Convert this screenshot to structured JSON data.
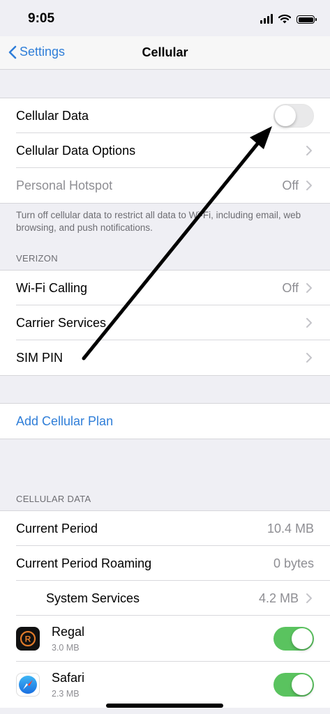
{
  "status_bar": {
    "time": "9:05"
  },
  "nav": {
    "back_label": "Settings",
    "title": "Cellular"
  },
  "main_group": {
    "cellular_data": {
      "label": "Cellular Data",
      "state": "off"
    },
    "cellular_data_options": {
      "label": "Cellular Data Options"
    },
    "personal_hotspot": {
      "label": "Personal Hotspot",
      "value": "Off"
    }
  },
  "main_footer": "Turn off cellular data to restrict all data to Wi-Fi, including email, web browsing, and push notifications.",
  "carrier": {
    "header": "VERIZON",
    "wifi_calling": {
      "label": "Wi-Fi Calling",
      "value": "Off"
    },
    "carrier_services": {
      "label": "Carrier Services"
    },
    "sim_pin": {
      "label": "SIM PIN"
    }
  },
  "add_plan": {
    "label": "Add Cellular Plan"
  },
  "usage": {
    "header": "CELLULAR DATA",
    "current_period": {
      "label": "Current Period",
      "value": "10.4 MB"
    },
    "current_period_roaming": {
      "label": "Current Period Roaming",
      "value": "0 bytes"
    },
    "system_services": {
      "label": "System Services",
      "value": "4.2 MB"
    },
    "apps": [
      {
        "name": "Regal",
        "size": "3.0 MB",
        "icon": "regal-app-icon",
        "enabled": true
      },
      {
        "name": "Safari",
        "size": "2.3 MB",
        "icon": "safari-app-icon",
        "enabled": true
      }
    ]
  },
  "colors": {
    "accent": "#2f7ed8",
    "toggle_on": "#5ac35f",
    "background": "#efeff4"
  }
}
